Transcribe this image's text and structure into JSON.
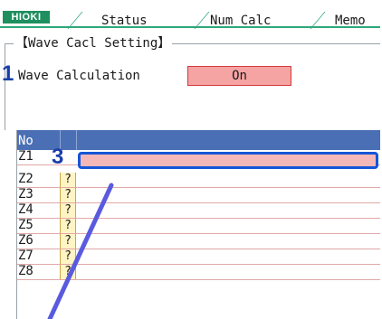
{
  "tabbar": {
    "logo": "HIOKI",
    "tabs": [
      {
        "label": "Status"
      },
      {
        "label": "Num Calc"
      },
      {
        "label": "Memo"
      }
    ]
  },
  "setting": {
    "title": "【Wave Cacl Setting】",
    "step_marker": "1",
    "wave_calculation_label": "Wave Calculation",
    "wave_calculation_value": "On"
  },
  "table": {
    "header_no": "No",
    "step_marker": "3",
    "rows": [
      {
        "label": "Z1",
        "flag": ""
      },
      {
        "label": "Z2",
        "flag": "?"
      },
      {
        "label": "Z3",
        "flag": "?"
      },
      {
        "label": "Z4",
        "flag": "?"
      },
      {
        "label": "Z5",
        "flag": "?"
      },
      {
        "label": "Z6",
        "flag": "?"
      },
      {
        "label": "Z7",
        "flag": "?"
      },
      {
        "label": "Z8",
        "flag": "?"
      }
    ]
  },
  "colors": {
    "accent_green": "#1f8f5f",
    "header_blue": "#4a6fb5",
    "toggle_pink": "#f5a3a3",
    "selection_blue": "#1556d8",
    "marker_blue": "#1a3ea8",
    "pointer_purple": "#5a5ae0"
  }
}
